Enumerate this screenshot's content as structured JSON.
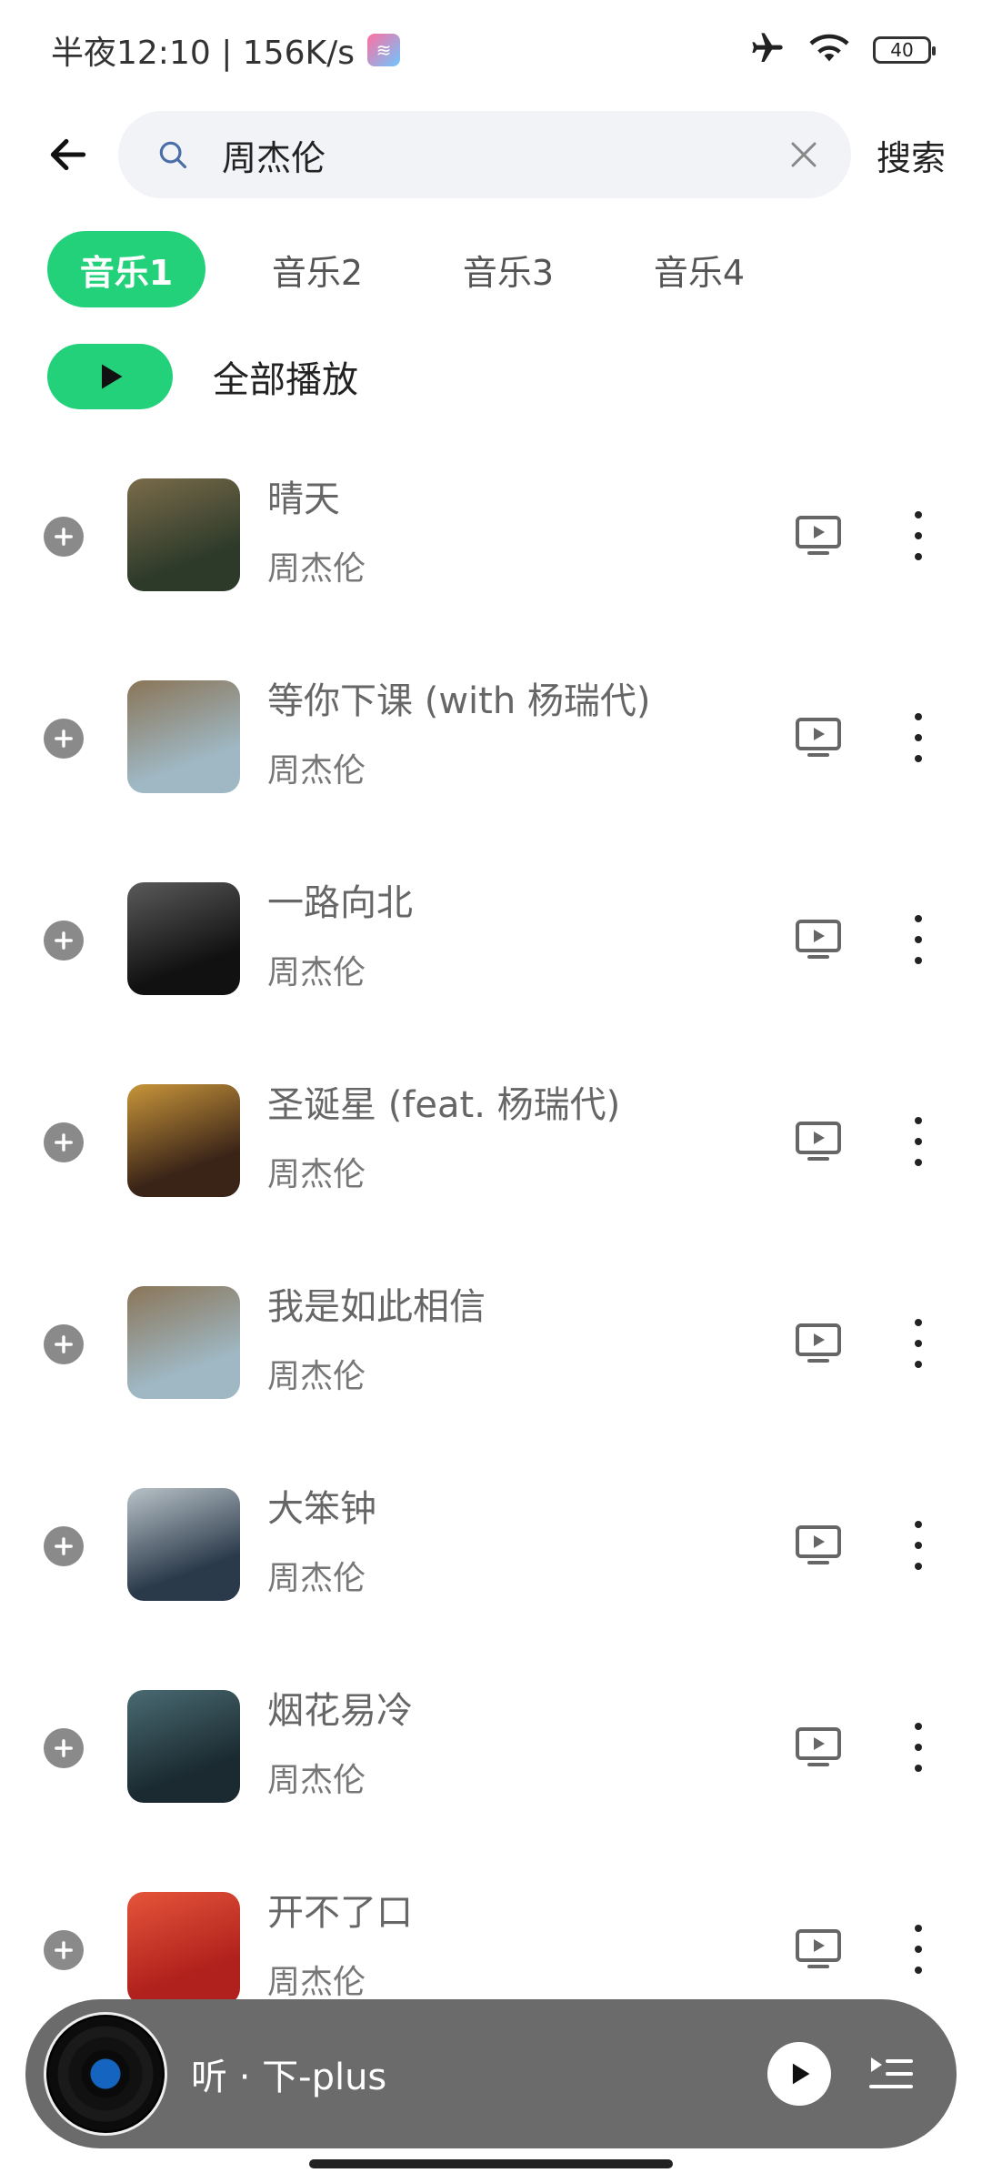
{
  "status_bar": {
    "time": "半夜12:10 | 156K/s",
    "app_icon_text": "≋",
    "battery": "40"
  },
  "search": {
    "query": "周杰伦",
    "submit_label": "搜索"
  },
  "tabs": [
    {
      "label": "音乐1",
      "active": true
    },
    {
      "label": "音乐2",
      "active": false
    },
    {
      "label": "音乐3",
      "active": false
    },
    {
      "label": "音乐4",
      "active": false
    }
  ],
  "play_all": {
    "label": "全部播放"
  },
  "songs": [
    {
      "title": "晴天",
      "artist": "周杰伦",
      "cover_colors": [
        "#2d3a2a",
        "#7a6b4a"
      ]
    },
    {
      "title": "等你下课 (with 杨瑞代)",
      "artist": "周杰伦",
      "cover_colors": [
        "#9fb8c4",
        "#8a7558"
      ]
    },
    {
      "title": "一路向北",
      "artist": "周杰伦",
      "cover_colors": [
        "#111111",
        "#5a5a5a"
      ]
    },
    {
      "title": "圣诞星 (feat. 杨瑞代)",
      "artist": "周杰伦",
      "cover_colors": [
        "#3a2418",
        "#c8953a"
      ]
    },
    {
      "title": "我是如此相信",
      "artist": "周杰伦",
      "cover_colors": [
        "#9fb8c4",
        "#8a7558"
      ]
    },
    {
      "title": "大笨钟",
      "artist": "周杰伦",
      "cover_colors": [
        "#2b3a4a",
        "#b8c2c8"
      ]
    },
    {
      "title": "烟花易冷",
      "artist": "周杰伦",
      "cover_colors": [
        "#1a2a30",
        "#4a6a72"
      ]
    },
    {
      "title": "开不了口",
      "artist": "周杰伦",
      "cover_colors": [
        "#b0201c",
        "#e4553a"
      ]
    }
  ],
  "mini_player": {
    "title": "听 · 下-plus"
  }
}
